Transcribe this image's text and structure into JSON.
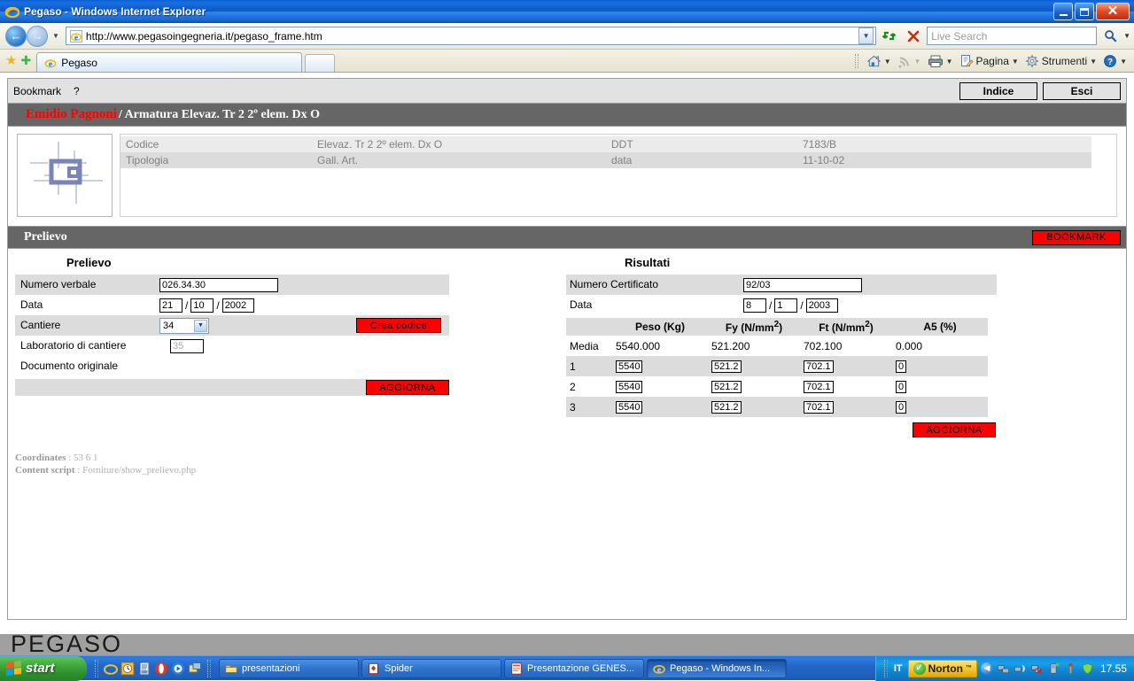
{
  "window": {
    "title": "Pegaso - Windows Internet Explorer",
    "minimize_label": "Minimize",
    "maximize_label": "Maximize",
    "close_label": "Close"
  },
  "browser": {
    "back_label": "Back",
    "forward_label": "Forward",
    "url": "http://www.pegasoingegneria.it/pegaso_frame.htm",
    "refresh_label": "Refresh",
    "stop_label": "Stop",
    "search_placeholder": "Live Search",
    "search_value": "",
    "tabs": [
      {
        "label": "Pegaso",
        "active": true
      }
    ],
    "new_tab_label": "New Tab",
    "commands": [
      {
        "label": "",
        "icon": "home-icon"
      },
      {
        "label": "",
        "icon": "feeds-icon"
      },
      {
        "label": "",
        "icon": "print-icon"
      },
      {
        "label": "Pagina",
        "icon": "page-icon"
      },
      {
        "label": "Strumenti",
        "icon": "tools-icon"
      },
      {
        "label": "",
        "icon": "help-icon"
      }
    ]
  },
  "app": {
    "toolbar": {
      "bookmark_label": "Bookmark",
      "help_label": "?",
      "indice_label": "Indice",
      "esci_label": "Esci"
    },
    "record_title": {
      "owner": "Emidio Pagnoni",
      "path": "/ Armatura Elevaz. Tr 2 2º elem. Dx O"
    },
    "detail": {
      "rows": [
        {
          "k1": "Codice",
          "v1": "Elevaz. Tr 2 2º elem. Dx O",
          "k2": "DDT",
          "v2": "7183/B"
        },
        {
          "k1": "Tipologia",
          "v1": "Gall. Art.",
          "k2": "data",
          "v2": "11-10-02"
        }
      ]
    },
    "section": {
      "title": "Prelievo",
      "bookmark_button": "BOOKMARK"
    },
    "prelievo": {
      "heading": "Prelievo",
      "numero_verbale_label": "Numero verbale",
      "numero_verbale_value": "026.34.30",
      "data_label": "Data",
      "data_day": "21",
      "data_month": "10",
      "data_year": "2002",
      "cantiere_label": "Cantiere",
      "cantiere_value": "34",
      "crea_codice_label": "Crea codice",
      "laboratorio_label": "Laboratorio di cantiere",
      "laboratorio_value": "35",
      "documento_label": "Documento originale",
      "aggiorna_label": "AGGIORNA"
    },
    "risultati": {
      "heading": "Risultati",
      "numero_certificato_label": "Numero Certificato",
      "numero_certificato_value": "92/03",
      "data_label": "Data",
      "data_day": "8",
      "data_month": "1",
      "data_year": "2003",
      "aggiorna_label": "AGGIORNA",
      "columns": [
        "",
        "Peso (Kg)",
        "Fy (N/mm2)",
        "Ft (N/mm2)",
        "A5 (%)"
      ],
      "media_row": {
        "label": "Media",
        "peso": "5540.000",
        "fy": "521.200",
        "ft": "702.100",
        "a5": "0.000"
      },
      "rows": [
        {
          "label": "1",
          "peso": "5540",
          "fy": "521.2",
          "ft": "702.1",
          "a5": "0"
        },
        {
          "label": "2",
          "peso": "5540",
          "fy": "521.2",
          "ft": "702.1",
          "a5": "0"
        },
        {
          "label": "3",
          "peso": "5540",
          "fy": "521.2",
          "ft": "702.1",
          "a5": "0"
        }
      ]
    },
    "footer": {
      "coordinates_label": "Coordinates",
      "coordinates_value": " : 53 6 1",
      "script_label": "Content script",
      "script_value": " : Forniture/show_prelievo.php"
    },
    "watermark": "PEGASO"
  },
  "taskbar": {
    "start_label": "start",
    "quicklaunch": [
      "ie-icon",
      "clock-icon",
      "notepad-icon",
      "opera-icon",
      "media-icon",
      "app-icon"
    ],
    "tasks": [
      {
        "label": "presentazioni",
        "icon": "folder-icon",
        "active": false
      },
      {
        "label": "Spider",
        "icon": "cards-icon",
        "active": false
      },
      {
        "label": "Presentazione GENES...",
        "icon": "powerpoint-icon",
        "active": false
      },
      {
        "label": "Pegaso - Windows In...",
        "icon": "ie-icon",
        "active": true
      }
    ],
    "tray": {
      "language": "IT",
      "norton_label": "Norton",
      "norton_tm": "™",
      "clock": "17.55",
      "icons": [
        "network-icon",
        "wireless-icon",
        "network-error-icon",
        "usb-icon",
        "update-icon",
        "shield-icon"
      ]
    }
  },
  "colors": {
    "accent_red": "#ff0000",
    "section_gray": "#666666",
    "shade_gray": "#dcdcdc",
    "taskbar_blue": "#1f5fbd"
  }
}
